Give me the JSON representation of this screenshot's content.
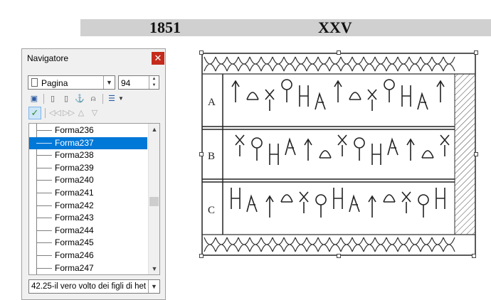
{
  "document": {
    "year": "1851",
    "roman_numeral": "XXV",
    "header_band_color": "#d0d0d0"
  },
  "navigator": {
    "title": "Navigatore",
    "close_icon": "close-icon",
    "content_type": "Pagina",
    "page_number": "94",
    "toolbar_icons": [
      "toggle-icon",
      "header-icon",
      "footer-icon",
      "anchor-icon",
      "reminder-icon",
      "heading-levels-icon"
    ],
    "promote_icons": [
      "checkmark-icon",
      "previous-chapter-icon",
      "next-chapter-icon",
      "promote-icon",
      "demote-icon"
    ],
    "items": [
      {
        "label": "Forma236"
      },
      {
        "label": "Forma237",
        "selected": true
      },
      {
        "label": "Forma238"
      },
      {
        "label": "Forma239"
      },
      {
        "label": "Forma240"
      },
      {
        "label": "Forma241"
      },
      {
        "label": "Forma242"
      },
      {
        "label": "Forma243"
      },
      {
        "label": "Forma244"
      },
      {
        "label": "Forma245"
      },
      {
        "label": "Forma246"
      },
      {
        "label": "Forma247"
      }
    ],
    "document_selector": "42.25-il vero volto dei figli di het",
    "selection_color": "#0078d7",
    "close_color": "#c42b1c"
  },
  "image": {
    "row_labels": [
      "A",
      "B",
      "C"
    ]
  }
}
